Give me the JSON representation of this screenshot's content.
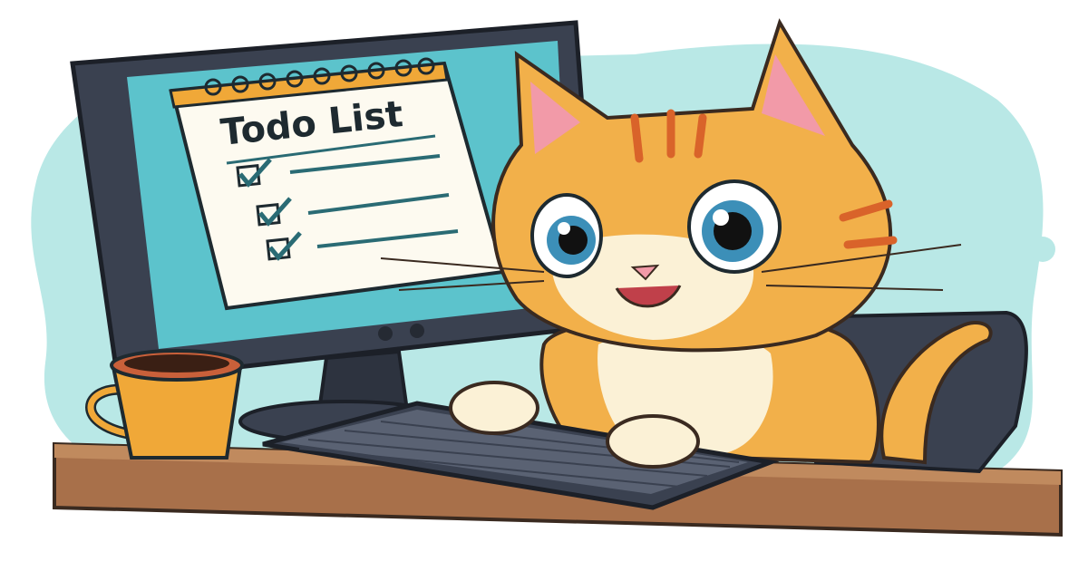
{
  "illustration": {
    "notepad_title": "Todo List",
    "todo_items": [
      {
        "checked": true
      },
      {
        "checked": true
      },
      {
        "checked": true
      }
    ]
  },
  "colors": {
    "background_blob": "#b9e8e6",
    "monitor": "#3a4150",
    "screen": "#5cc3cc",
    "desk": "#a8704a",
    "cat_orange": "#f2b04a",
    "cat_stripe": "#d9632a",
    "cat_cream": "#fbf1d6",
    "mug": "#f0a838",
    "check": "#2a6b74"
  }
}
